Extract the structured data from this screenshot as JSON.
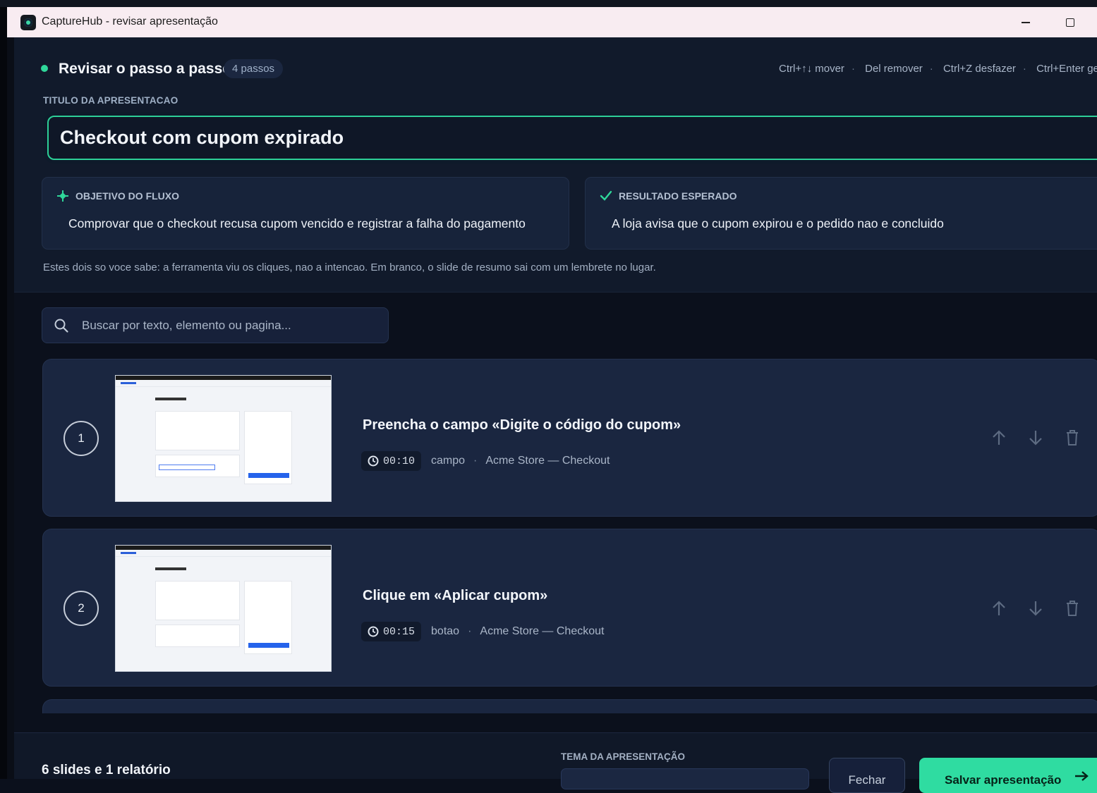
{
  "window": {
    "title": "CaptureHub - revisar apresentação"
  },
  "header": {
    "title": "Revisar o passo a passo",
    "steps_badge": "4 passos",
    "shortcuts": [
      "Ctrl+↑↓ mover",
      "Del remover",
      "Ctrl+Z desfazer",
      "Ctrl+Enter ge"
    ]
  },
  "presentation": {
    "title_label": "TITULO DA APRESENTACAO",
    "title_value": "Checkout com cupom expirado"
  },
  "objective": {
    "label": "OBJETIVO DO FLUXO",
    "text": "Comprovar que o checkout recusa cupom vencido e registrar a falha do pagamento"
  },
  "expected": {
    "label": "RESULTADO ESPERADO",
    "text": "A loja avisa que o cupom expirou e o pedido nao e concluido"
  },
  "note": "Estes dois so voce sabe: a ferramenta viu os cliques, nao a intencao. Em branco, o slide de resumo sai com um lembrete no lugar.",
  "search": {
    "placeholder": "Buscar por texto, elemento ou pagina..."
  },
  "steps": [
    {
      "number": "1",
      "title": "Preencha o campo «Digite o código do cupom»",
      "time": "00:10",
      "kind": "campo",
      "page": "Acme Store — Checkout"
    },
    {
      "number": "2",
      "title": "Clique em «Aplicar cupom»",
      "time": "00:15",
      "kind": "botao",
      "page": "Acme Store — Checkout"
    }
  ],
  "footer": {
    "summary": "6 slides e 1 relatório",
    "theme_label": "TEMA DA APRESENTAÇÃO",
    "close_label": "Fechar",
    "save_label": "Salvar apresentação"
  },
  "colors": {
    "accent": "#2fdca1",
    "background": "#0b101c",
    "card": "#1a2640"
  },
  "icons": [
    "app-icon",
    "minimize-icon",
    "maximize-icon",
    "status-dot",
    "target-icon",
    "check-icon",
    "search-icon",
    "clock-icon",
    "arrow-up-icon",
    "arrow-down-icon",
    "trash-icon",
    "arrow-right-icon"
  ]
}
